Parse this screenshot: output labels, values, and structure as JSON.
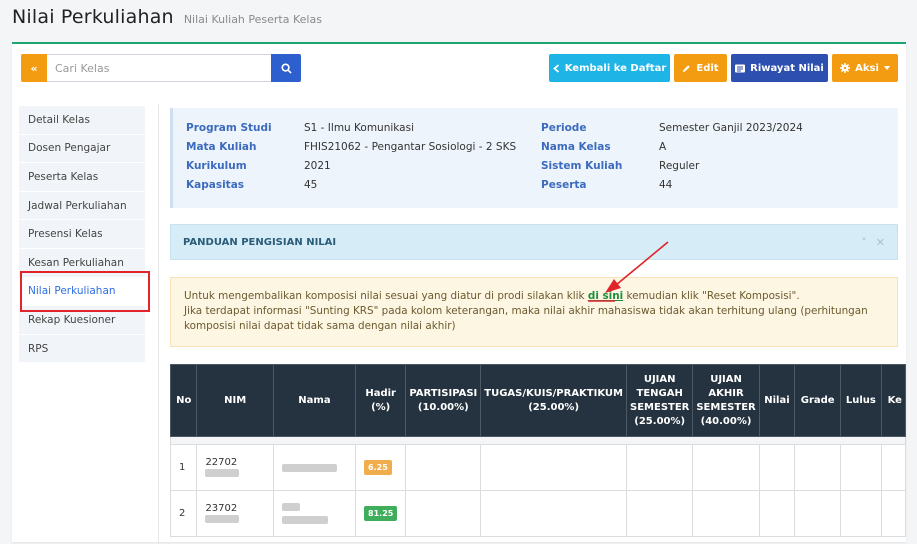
{
  "header": {
    "title": "Nilai Perkuliahan",
    "subtitle": "Nilai Kuliah Peserta Kelas"
  },
  "toolbar": {
    "search_toggle": "«",
    "search_placeholder": "Cari Kelas",
    "back_label": "Kembali ke Daftar",
    "edit_label": "Edit",
    "history_label": "Riwayat Nilai",
    "action_label": "Aksi"
  },
  "sidebar": {
    "items": [
      {
        "label": "Detail Kelas"
      },
      {
        "label": "Dosen Pengajar"
      },
      {
        "label": "Peserta Kelas"
      },
      {
        "label": "Jadwal Perkuliahan"
      },
      {
        "label": "Presensi Kelas"
      },
      {
        "label": "Kesan Perkuliahan"
      },
      {
        "label": "Nilai Perkuliahan"
      },
      {
        "label": "Rekap Kuesioner"
      },
      {
        "label": "RPS"
      }
    ]
  },
  "info": {
    "program_studi": {
      "label": "Program Studi",
      "value": "S1 - Ilmu Komunikasi"
    },
    "mata_kuliah": {
      "label": "Mata Kuliah",
      "value": "FHIS21062 - Pengantar Sosiologi - 2 SKS"
    },
    "kurikulum": {
      "label": "Kurikulum",
      "value": "2021"
    },
    "kapasitas": {
      "label": "Kapasitas",
      "value": "45"
    },
    "periode": {
      "label": "Periode",
      "value": "Semester Ganjil 2023/2024"
    },
    "nama_kelas": {
      "label": "Nama Kelas",
      "value": "A"
    },
    "sistem_kuliah": {
      "label": "Sistem Kuliah",
      "value": "Reguler"
    },
    "peserta": {
      "label": "Peserta",
      "value": "44"
    }
  },
  "guide": {
    "title": "PANDUAN PENGISIAN NILAI",
    "collapse_icon": "˅",
    "close_icon": "✕"
  },
  "alert": {
    "line1_a": "Untuk mengembalikan komposisi nilai sesuai yang diatur di prodi silakan klik ",
    "link": "di sini",
    "line1_b": " kemudian klik \"Reset Komposisi\".",
    "line2": "Jika terdapat informasi \"Sunting KRS\" pada kolom keterangan, maka nilai akhir mahasiswa tidak akan terhitung ulang (perhitungan komposisi nilai dapat tidak sama dengan nilai akhir)"
  },
  "table": {
    "headers": {
      "no": "No",
      "nim": "NIM",
      "nama": "Nama",
      "hadir": "Hadir (%)",
      "partisipasi": "PARTISIPASI (10.00%)",
      "tugas": "TUGAS/KUIS/PRAKTIKUM (25.00%)",
      "uts": "UJIAN TENGAH SEMESTER (25.00%)",
      "uas": "UJIAN AKHIR SEMESTER (40.00%)",
      "nilai": "Nilai",
      "grade": "Grade",
      "lulus": "Lulus",
      "ket": "Ke"
    },
    "rows": [
      {
        "no": "1",
        "nim": "22702",
        "hadir": "6.25",
        "hadir_color": "#f0ad4e"
      },
      {
        "no": "2",
        "nim": "23702",
        "hadir": "81.25",
        "hadir_color": "#3fae5c"
      }
    ]
  },
  "colors": {
    "accent": "#1ea672",
    "primary": "#2d5fcf",
    "warning": "#f39c12",
    "info": "#1fb4e6",
    "highlight": "#e0242a"
  }
}
